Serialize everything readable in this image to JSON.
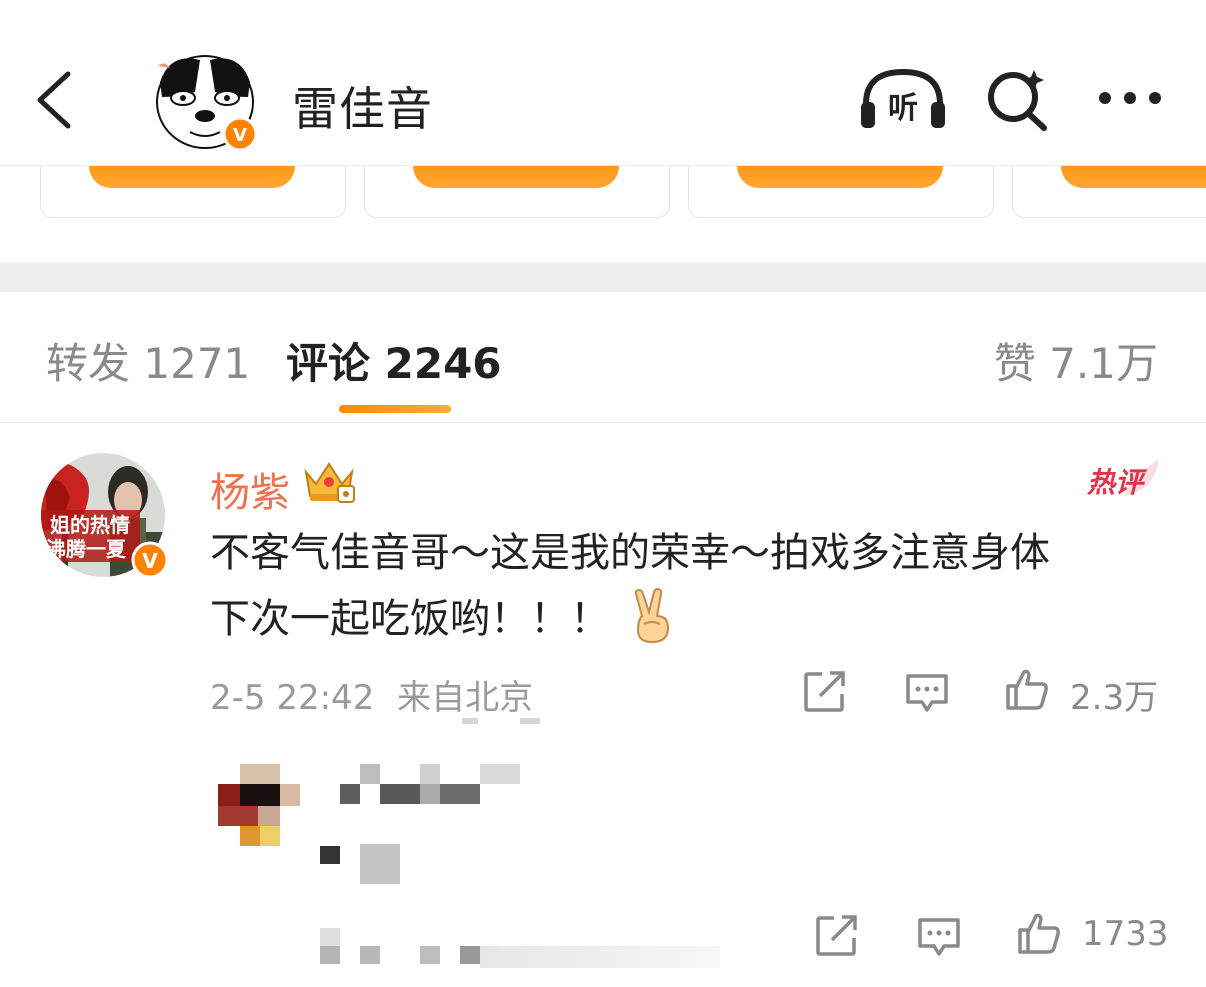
{
  "header": {
    "author_name": "雷佳音",
    "listen_label": "听",
    "icons": [
      "back-icon",
      "listen-icon",
      "search-icon",
      "more-icon"
    ]
  },
  "tabs": [
    {
      "label": "转发 1271",
      "active": false
    },
    {
      "label": "评论 2246",
      "active": true
    },
    {
      "label": "赞 7.1万",
      "active": false
    }
  ],
  "comment": {
    "user": "杨紫",
    "hot_badge": "热评",
    "text_line1": "不客气佳音哥～这是我的荣幸～拍戏多注意身体",
    "text_line2": "下次一起吃饭哟！！！",
    "time": "2-5 22:42",
    "location": "来自北京",
    "likes": "2.3万"
  },
  "reply": {
    "likes": "1733"
  },
  "colors": {
    "accent": "#ff9a1a",
    "username": "#eb7350",
    "hot_badge": "#e0344a"
  }
}
